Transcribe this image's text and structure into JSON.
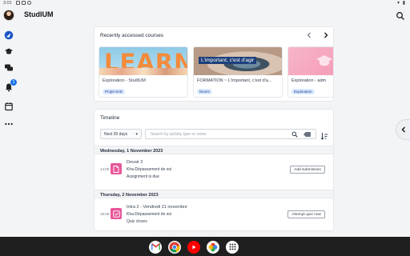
{
  "status_bar": {
    "time": "3:01"
  },
  "app": {
    "title": "StudIUM"
  },
  "recent": {
    "heading": "Recently accessed courses",
    "courses": [
      {
        "name": "Exploration - StudIUM",
        "category": "Projet SAE",
        "image_text": "LEARN"
      },
      {
        "name": "FORMATION ~ L'important, c'est d'a...",
        "category": "Divers",
        "image_text": "L'important, c'est d'agir"
      },
      {
        "name": "Exploration - adm",
        "category": "Exploration"
      }
    ]
  },
  "timeline": {
    "heading": "Timeline",
    "filter": "Next 30 days",
    "search_placeholder": "Search by activity type or name",
    "days": [
      {
        "date": "Wednesday, 1 November 2023",
        "event": {
          "time": "14:00",
          "name": "Devoir 2",
          "course": "Kha-Dépassement de soi",
          "status": "Assignment is due",
          "action": "Add submission",
          "icon": "assignment-icon"
        }
      },
      {
        "date": "Thursday, 2 November 2023",
        "event": {
          "time": "16:25",
          "name": "Intra 2 - Vendredi 21 novembre",
          "course": "Kha-Dépassement de soi",
          "status": "Quiz closes",
          "action": "Attempt quiz now",
          "icon": "quiz-icon"
        }
      }
    ]
  },
  "colors": {
    "accent": "#1a73e8",
    "activity_pink": "#e8569a",
    "category_bg": "#dbeafe"
  },
  "rail_icons": [
    "dashboard-icon",
    "courses-icon",
    "messages-icon",
    "notifications-icon",
    "calendar-icon",
    "more-icon"
  ],
  "notification_count": "1",
  "dock_apps": [
    "gmail-icon",
    "chrome-icon",
    "youtube-icon",
    "photos-icon",
    "app-drawer-icon"
  ]
}
